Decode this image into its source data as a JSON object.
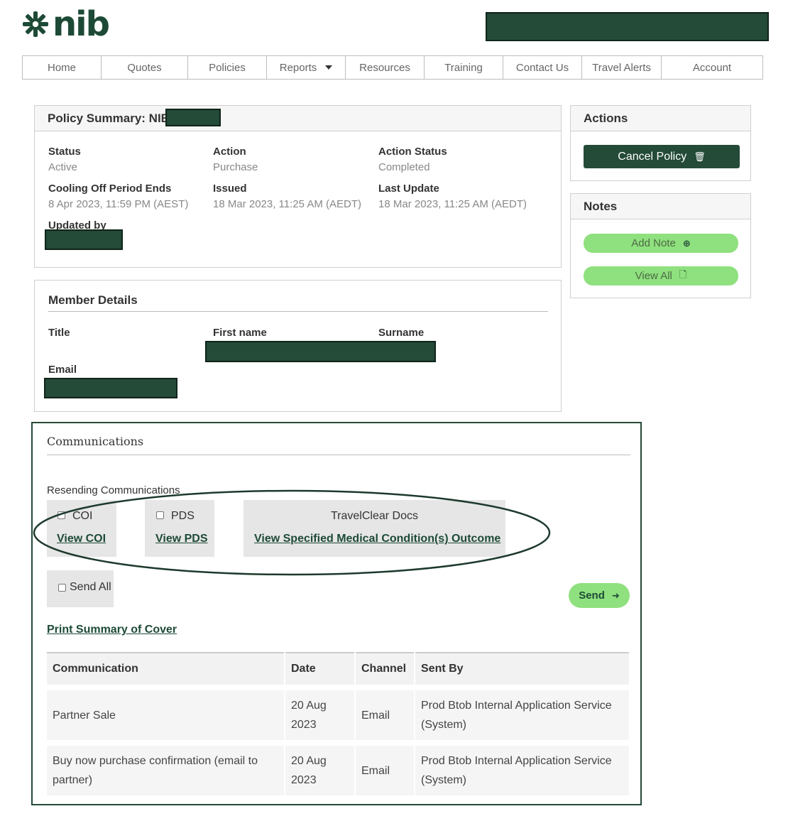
{
  "brand": {
    "logo_text": "nib",
    "logo_icon": "nib-flower-icon",
    "color": "#1d4a36"
  },
  "nav": {
    "items": [
      {
        "label": "Home"
      },
      {
        "label": "Quotes"
      },
      {
        "label": "Policies"
      },
      {
        "label": "Reports"
      },
      {
        "label": "Resources"
      },
      {
        "label": "Training"
      },
      {
        "label": "Contact Us"
      },
      {
        "label": "Travel Alerts"
      },
      {
        "label": "Account"
      }
    ]
  },
  "policy_summary": {
    "title": "Policy Summary: NIB",
    "fields": {
      "status_label": "Status",
      "status_value": "Active",
      "action_label": "Action",
      "action_value": "Purchase",
      "action_status_label": "Action Status",
      "action_status_value": "Completed",
      "cooling_label": "Cooling Off Period Ends",
      "cooling_value": "8 Apr 2023, 11:59 PM (AEST)",
      "issued_label": "Issued",
      "issued_value": "18 Mar 2023, 11:25 AM (AEDT)",
      "last_update_label": "Last Update",
      "last_update_value": "18 Mar 2023, 11:25 AM (AEDT)",
      "updated_by_label": "Updated by"
    }
  },
  "actions": {
    "title": "Actions",
    "cancel_label": "Cancel Policy"
  },
  "notes": {
    "title": "Notes",
    "add_label": "Add Note",
    "view_all_label": "View All"
  },
  "member": {
    "title": "Member Details",
    "title_label": "Title",
    "first_name_label": "First name",
    "surname_label": "Surname",
    "email_label": "Email"
  },
  "communications": {
    "title": "Communications",
    "resend_label": "Resending Communications",
    "coi_label": "COI",
    "view_coi": "View COI",
    "pds_label": "PDS",
    "view_pds": "View PDS",
    "travelclear_label": "TravelClear Docs",
    "view_smc": "View Specified Medical Condition(s) Outcome",
    "send_all_label": "Send All",
    "send_label": "Send",
    "print_label": "Print Summary of Cover",
    "table": {
      "headers": [
        "Communication",
        "Date",
        "Channel",
        "Sent By"
      ],
      "rows": [
        [
          "Partner Sale",
          "20 Aug 2023",
          "Email",
          "Prod Btob Internal Application Service (System)"
        ],
        [
          "Buy now purchase confirmation (email to partner)",
          "20 Aug 2023",
          "Email",
          "Prod Btob Internal Application Service (System)"
        ]
      ]
    }
  }
}
